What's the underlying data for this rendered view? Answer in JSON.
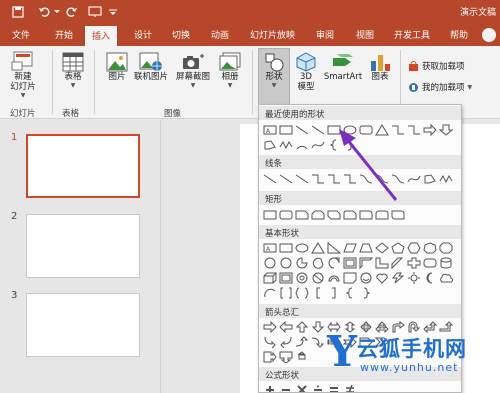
{
  "window": {
    "title": "演示文稿"
  },
  "tabs": [
    {
      "label": "文件"
    },
    {
      "label": "开始"
    },
    {
      "label": "插入"
    },
    {
      "label": "设计"
    },
    {
      "label": "切换"
    },
    {
      "label": "动画"
    },
    {
      "label": "幻灯片放映"
    },
    {
      "label": "审阅"
    },
    {
      "label": "视图"
    },
    {
      "label": "开发工具"
    },
    {
      "label": "帮助"
    }
  ],
  "ribbon": {
    "new_slide": {
      "line1": "新建",
      "line2": "幻灯片"
    },
    "table": "表格",
    "picture": "图片",
    "online_picture": "联机图片",
    "screenshot": "屏幕截图",
    "album": "相册",
    "shapes": "形状",
    "model3d": {
      "line1": "3D",
      "line2": "模型"
    },
    "smartart": "SmartArt",
    "chart": "图表",
    "get_addins": "获取加载项",
    "my_addins": "我的加载项",
    "groups": {
      "slides": "幻灯片",
      "tables": "表格",
      "images": "图像"
    }
  },
  "slides": [
    {
      "number": "1"
    },
    {
      "number": "2"
    },
    {
      "number": "3"
    }
  ],
  "shapes_menu": {
    "sections": [
      {
        "title": "最近使用的形状"
      },
      {
        "title": "线条"
      },
      {
        "title": "矩形"
      },
      {
        "title": "基本形状"
      },
      {
        "title": "箭头总汇"
      },
      {
        "title": "公式形状"
      }
    ]
  },
  "watermark": {
    "letter": "Y",
    "name": "云狐手机网",
    "url": "www.yunhu.net"
  },
  "colors": {
    "accent": "#b7472a",
    "selected_slide": "#d24726",
    "annotation": "#7b2fbf",
    "watermark": "#1f6fd1"
  }
}
